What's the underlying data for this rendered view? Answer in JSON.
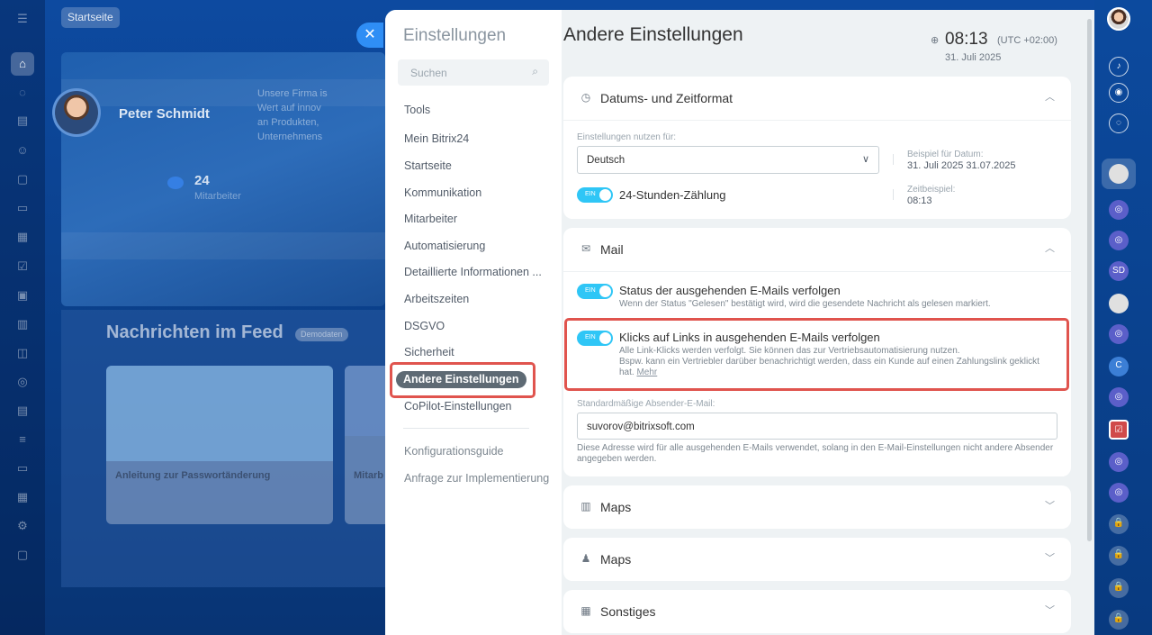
{
  "background": {
    "breadcrumb": "Startseite",
    "profile_name": "Peter Schmidt",
    "profile_text": "Unsere Firma is Wert auf innov an Produkten, Unternehmens",
    "employee_count": "24",
    "employee_label": "Mitarbeiter",
    "feed_title": "Nachrichten im Feed",
    "feed_badge": "Demodaten",
    "card1_title": "Anleitung zur Passwortänderung",
    "card2_title": "Mitarb"
  },
  "nav": {
    "title": "Einstellungen",
    "search_placeholder": "Suchen",
    "items": [
      "Tools",
      "Mein Bitrix24",
      "Startseite",
      "Kommunikation",
      "Mitarbeiter",
      "Automatisierung",
      "Detaillierte Informationen ...",
      "Arbeitszeiten",
      "DSGVO",
      "Sicherheit",
      "Andere Einstellungen",
      "CoPilot-Einstellungen"
    ],
    "extra_items": [
      "Konfigurationsguide",
      "Anfrage zur Implementierung"
    ]
  },
  "page": {
    "title": "Andere Einstellungen",
    "time": "08:13",
    "timezone": "(UTC +02:00)",
    "date": "31. Juli 2025"
  },
  "datetime_panel": {
    "title": "Datums- und Zeitformat",
    "use_for_label": "Einstellungen nutzen für:",
    "language": "Deutsch",
    "date_example_label": "Beispiel für Datum:",
    "date_example": "31. Juli 2025 31.07.2025",
    "toggle_label": "EIN",
    "hours24_label": "24-Stunden-Zählung",
    "time_example_label": "Zeitbeispiel:",
    "time_example": "08:13"
  },
  "mail_panel": {
    "title": "Mail",
    "opt1_title": "Status der ausgehenden E-Mails verfolgen",
    "opt1_desc": "Wenn der Status \"Gelesen\" bestätigt wird, wird die gesendete Nachricht als gelesen markiert.",
    "opt2_title": "Klicks auf Links in ausgehenden E-Mails verfolgen",
    "opt2_desc1": "Alle Link-Klicks werden verfolgt. Sie können das zur Vertriebsautomatisierung nutzen.",
    "opt2_desc2": "Bspw. kann ein Vertriebler darüber benachrichtigt werden, dass ein Kunde auf einen Zahlungslink geklickt",
    "opt2_desc3": "hat.",
    "opt2_more": "Mehr",
    "sender_label": "Standardmäßige Absender-E-Mail:",
    "sender_value": "suvorov@bitrixsoft.com",
    "sender_hint": "Diese Adresse wird für alle ausgehenden E-Mails verwendet, solang in den E-Mail-Einstellungen nicht andere Absender angegeben werden."
  },
  "collapsed_panels": [
    "Maps",
    "Maps",
    "Sonstiges"
  ],
  "colors": {
    "accent": "#2fc6f6",
    "highlight": "#e0544e",
    "active_nav": "#5e6a74"
  }
}
